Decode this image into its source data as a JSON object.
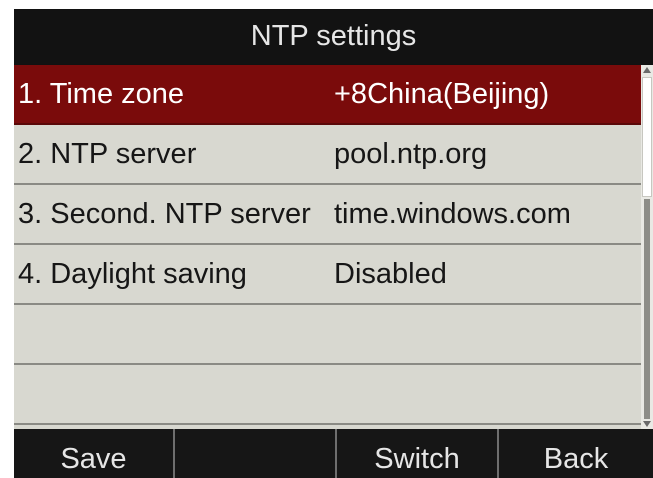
{
  "header": {
    "title": "NTP settings"
  },
  "rows": [
    {
      "label": "1. Time zone",
      "value": "+8China(Beijing)",
      "selected": true
    },
    {
      "label": "2. NTP server",
      "value": "pool.ntp.org",
      "selected": false
    },
    {
      "label": "3. Second. NTP server",
      "value": "time.windows.com",
      "selected": false
    },
    {
      "label": "4. Daylight saving",
      "value": "Disabled",
      "selected": false
    },
    {
      "label": "",
      "value": "",
      "selected": false
    },
    {
      "label": "",
      "value": "",
      "selected": false
    }
  ],
  "softkeys": [
    {
      "label": "Save"
    },
    {
      "label": ""
    },
    {
      "label": "Switch"
    },
    {
      "label": "Back"
    }
  ],
  "colors": {
    "selected_row_bg": "#7a0b0b",
    "list_bg": "#d8d8d0",
    "bar_bg": "#121212"
  }
}
